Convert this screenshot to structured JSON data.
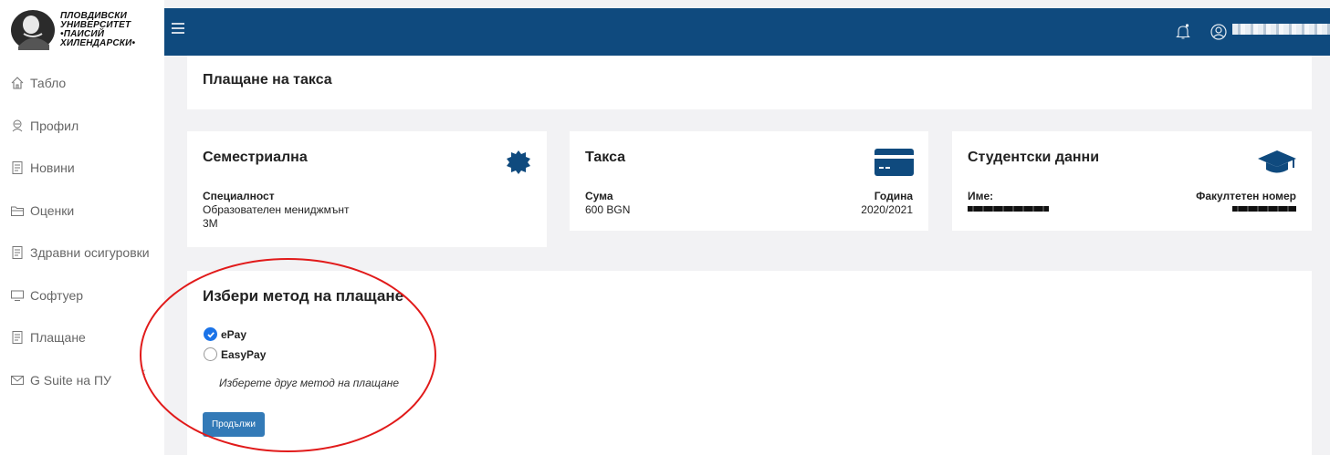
{
  "logo": {
    "lines": [
      "ПЛОВДИВСКИ",
      "УНИВЕРСИТЕТ",
      "•ПАИСИЙ",
      "ХИЛЕНДАРСКИ•"
    ]
  },
  "sidebar": {
    "items": [
      {
        "label": "Табло",
        "icon": "home-icon"
      },
      {
        "label": "Профил",
        "icon": "profile-icon"
      },
      {
        "label": "Новини",
        "icon": "document-icon"
      },
      {
        "label": "Оценки",
        "icon": "folder-icon"
      },
      {
        "label": "Здравни осигуровки",
        "icon": "document-icon"
      },
      {
        "label": "Софтуер",
        "icon": "monitor-icon"
      },
      {
        "label": "Плащане",
        "icon": "document-icon"
      },
      {
        "label": "G Suite на ПУ",
        "icon": "mail-icon"
      }
    ],
    "collapse_glyph": "‹"
  },
  "header": {
    "bg": "#0f4a7e"
  },
  "page": {
    "title": "Плащане на такса"
  },
  "cards": {
    "semester": {
      "title": "Семестриална",
      "specialty_label": "Специалност",
      "specialty_value": "Образователен мениджмънт",
      "specialty_code": "3М"
    },
    "fee": {
      "title": "Такса",
      "amount_label": "Сума",
      "amount_value": "600 BGN",
      "year_label": "Година",
      "year_value": "2020/2021"
    },
    "student": {
      "title": "Студентски данни",
      "name_label": "Име:",
      "faculty_no_label": "Факултетен номер"
    }
  },
  "payment": {
    "title": "Избери метод на плащане",
    "options": [
      {
        "label": "ePay",
        "checked": true
      },
      {
        "label": "EasyPay",
        "checked": false
      }
    ],
    "other_method": "Изберете друг метод на плащане",
    "continue_label": "Продължи"
  },
  "colors": {
    "accent": "#1a73e8",
    "button": "#337ab7",
    "highlight": "#e11a1a"
  }
}
